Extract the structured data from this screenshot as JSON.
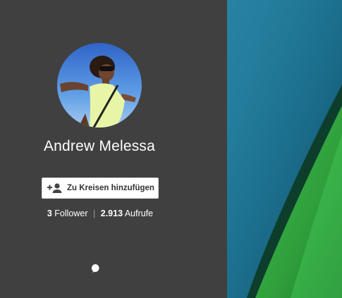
{
  "profile": {
    "name": "Andrew Melessa",
    "add_button_label": "Zu Kreisen hinzufügen",
    "followers_count": "3",
    "followers_label": "Follower",
    "separator": "|",
    "views_count": "2.913",
    "views_label": "Aufrufe"
  },
  "icons": {
    "add_person": "add-person-icon",
    "comment": "comment-icon"
  },
  "colors": {
    "panel_background": "#404040",
    "cover_blue": "#1c6f8e",
    "cover_green": "#2f9f3b"
  }
}
